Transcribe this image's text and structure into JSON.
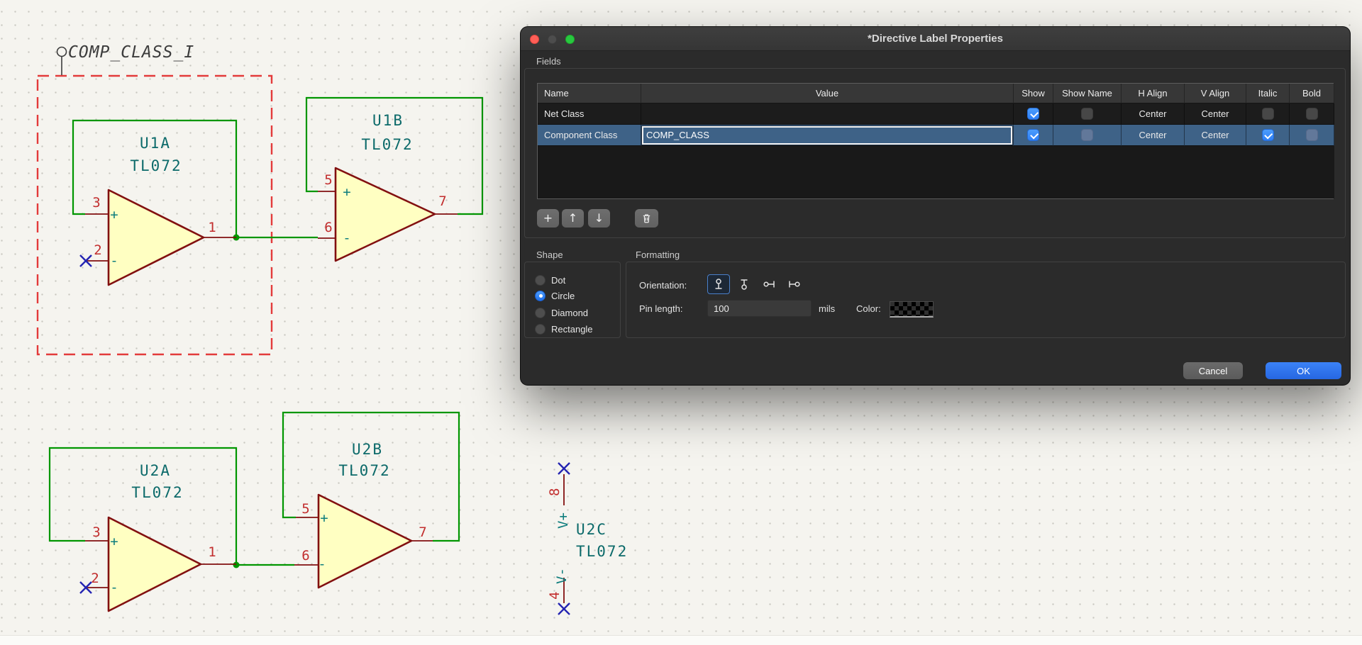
{
  "dialog": {
    "title": "*Directive Label Properties",
    "fields_label": "Fields",
    "table": {
      "columns": [
        "Name",
        "Value",
        "Show",
        "Show Name",
        "H Align",
        "V Align",
        "Italic",
        "Bold"
      ],
      "rows": [
        {
          "name": "Net Class",
          "value": "",
          "show": true,
          "show_name": false,
          "h_align": "Center",
          "v_align": "Center",
          "italic": false,
          "bold": false
        },
        {
          "name": "Component Class",
          "value": "COMP_CLASS",
          "show": true,
          "show_name": false,
          "h_align": "Center",
          "v_align": "Center",
          "italic": true,
          "bold": false
        }
      ]
    },
    "toolbar": {
      "add": "+",
      "move_up": "↑",
      "move_down": "↓"
    },
    "shape": {
      "label": "Shape",
      "options": [
        {
          "label": "Dot",
          "selected": false
        },
        {
          "label": "Circle",
          "selected": true
        },
        {
          "label": "Diamond",
          "selected": false
        },
        {
          "label": "Rectangle",
          "selected": false
        }
      ]
    },
    "formatting": {
      "label": "Formatting",
      "orientation_label": "Orientation:",
      "orientations": [
        {
          "name": "up",
          "selected": true
        },
        {
          "name": "down",
          "selected": false
        },
        {
          "name": "left",
          "selected": false
        },
        {
          "name": "right",
          "selected": false
        }
      ],
      "pin_length_label": "Pin length:",
      "pin_length_value": "100",
      "pin_length_unit": "mils",
      "color_label": "Color:"
    },
    "buttons": {
      "cancel": "Cancel",
      "ok": "OK"
    }
  },
  "schematic": {
    "directive_label": "COMP_CLASS_I",
    "plus_sign": "+",
    "minus_sign": "-",
    "opamps": [
      {
        "ref": "U1A",
        "value": "TL072",
        "pins": {
          "plus_num": "3",
          "minus_num": "2",
          "out_num": "1"
        }
      },
      {
        "ref": "U1B",
        "value": "TL072",
        "pins": {
          "plus_num": "5",
          "minus_num": "6",
          "out_num": "7"
        }
      },
      {
        "ref": "U2A",
        "value": "TL072",
        "pins": {
          "plus_num": "3",
          "minus_num": "2",
          "out_num": "1"
        }
      },
      {
        "ref": "U2B",
        "value": "TL072",
        "pins": {
          "plus_num": "5",
          "minus_num": "6",
          "out_num": "7"
        }
      },
      {
        "ref": "U2C",
        "value": "TL072",
        "pins": {
          "vplus_num": "8",
          "vplus_name": "V+",
          "vminus_num": "4",
          "vminus_name": "V-"
        }
      }
    ]
  },
  "colors": {
    "accent": "#2E80F7",
    "ok_button": "#2667E2",
    "selection": "#3E6287",
    "wire": "#009600",
    "symbol_outline": "#821010",
    "symbol_fill": "#FFFFC2",
    "pin_number": "#C22E2E",
    "pin_name": "#0E7D7D",
    "ref_text": "#0C6A6A",
    "no_connect": "#2424B2",
    "rule_area": "#E33B3B",
    "canvas_bg": "#F5F4EF",
    "grid_dot": "#C9C8C1",
    "label_text": "#3C3C3C"
  }
}
